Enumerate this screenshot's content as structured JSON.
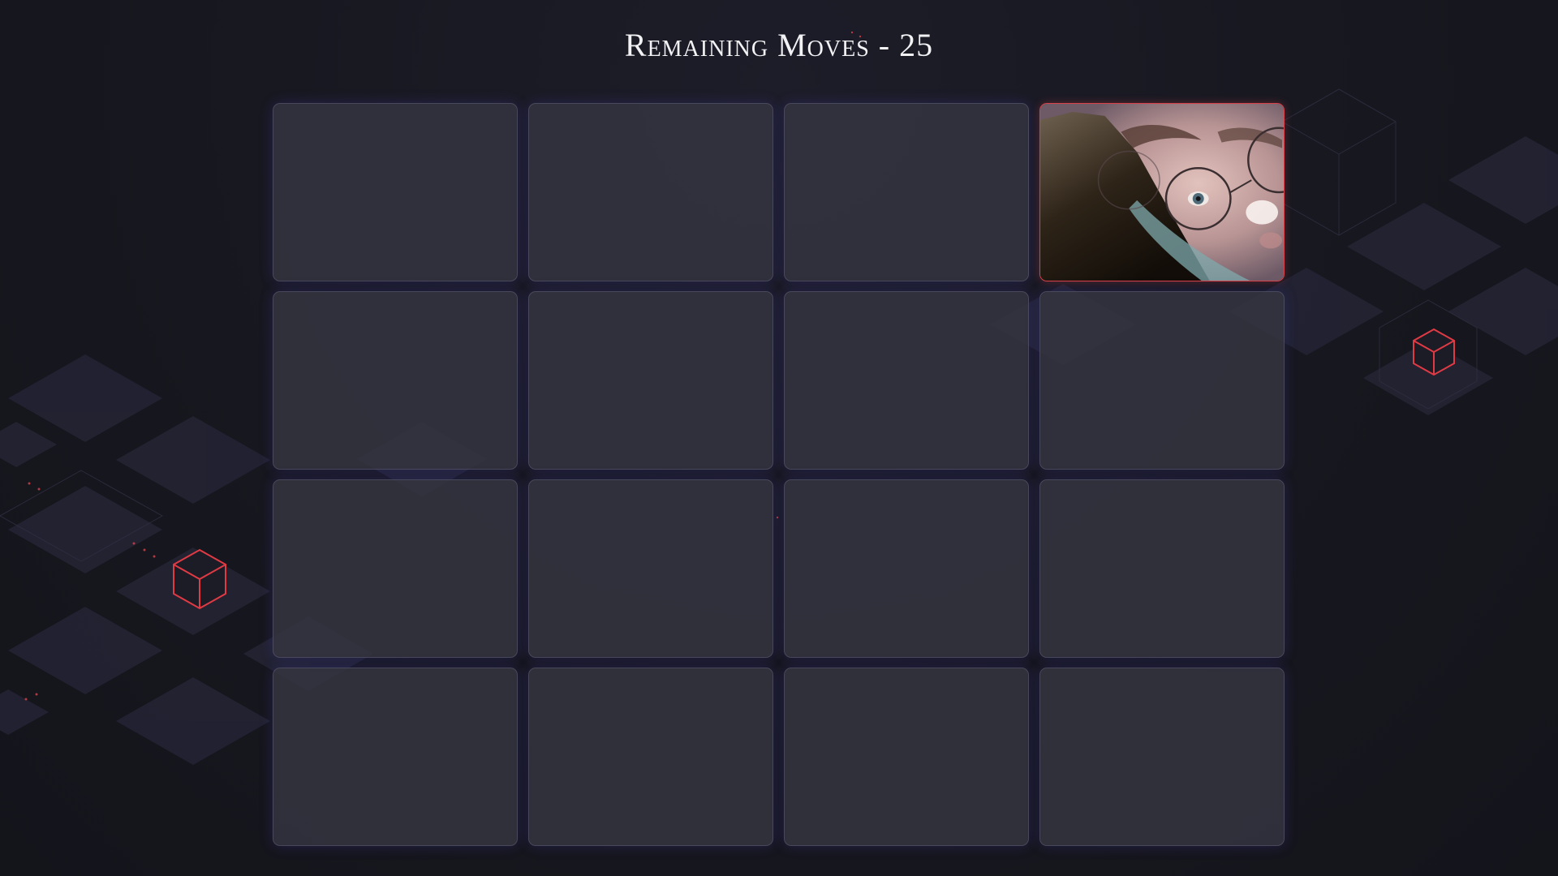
{
  "game": {
    "title": "Remaining Moves - 25",
    "remaining_moves": 25,
    "grid": {
      "rows": 4,
      "columns": 4
    },
    "cards": [
      {
        "state": "hidden"
      },
      {
        "state": "hidden"
      },
      {
        "state": "hidden"
      },
      {
        "state": "revealed",
        "image": "boy-with-glasses-photo-icon"
      },
      {
        "state": "hidden"
      },
      {
        "state": "hidden"
      },
      {
        "state": "hidden"
      },
      {
        "state": "hidden"
      },
      {
        "state": "hidden"
      },
      {
        "state": "hidden"
      },
      {
        "state": "hidden"
      },
      {
        "state": "hidden"
      },
      {
        "state": "hidden"
      },
      {
        "state": "hidden"
      },
      {
        "state": "hidden"
      },
      {
        "state": "hidden"
      }
    ]
  },
  "theme": {
    "background": "#16161f",
    "card_face_down": "#363642",
    "accent_red": "#d8424a",
    "glow": "#463cb4"
  },
  "decorations": {
    "icons": [
      "red-cube-outline-icon",
      "isometric-tile-pattern-icon"
    ]
  }
}
